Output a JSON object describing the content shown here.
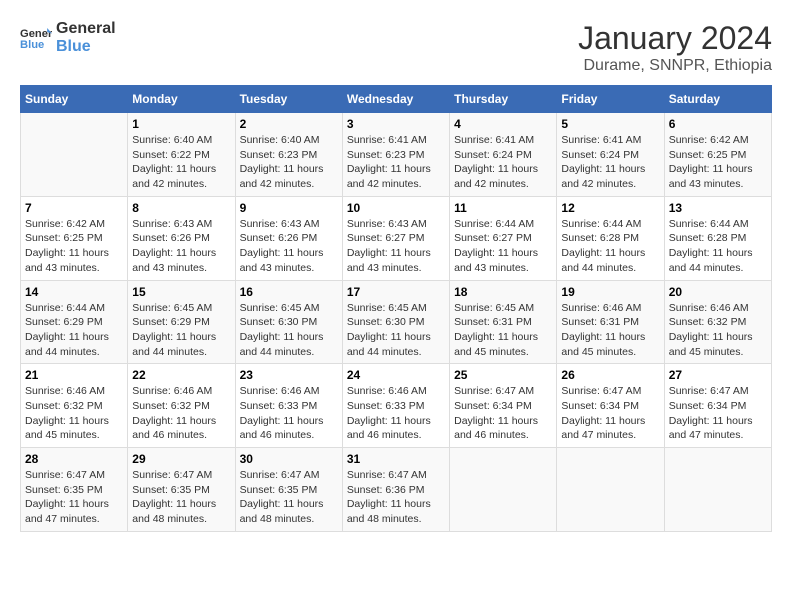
{
  "logo": {
    "line1": "General",
    "line2": "Blue"
  },
  "title": "January 2024",
  "subtitle": "Durame, SNNPR, Ethiopia",
  "days_header": [
    "Sunday",
    "Monday",
    "Tuesday",
    "Wednesday",
    "Thursday",
    "Friday",
    "Saturday"
  ],
  "weeks": [
    [
      {
        "day": "",
        "info": ""
      },
      {
        "day": "1",
        "info": "Sunrise: 6:40 AM\nSunset: 6:22 PM\nDaylight: 11 hours\nand 42 minutes."
      },
      {
        "day": "2",
        "info": "Sunrise: 6:40 AM\nSunset: 6:23 PM\nDaylight: 11 hours\nand 42 minutes."
      },
      {
        "day": "3",
        "info": "Sunrise: 6:41 AM\nSunset: 6:23 PM\nDaylight: 11 hours\nand 42 minutes."
      },
      {
        "day": "4",
        "info": "Sunrise: 6:41 AM\nSunset: 6:24 PM\nDaylight: 11 hours\nand 42 minutes."
      },
      {
        "day": "5",
        "info": "Sunrise: 6:41 AM\nSunset: 6:24 PM\nDaylight: 11 hours\nand 42 minutes."
      },
      {
        "day": "6",
        "info": "Sunrise: 6:42 AM\nSunset: 6:25 PM\nDaylight: 11 hours\nand 43 minutes."
      }
    ],
    [
      {
        "day": "7",
        "info": "Sunrise: 6:42 AM\nSunset: 6:25 PM\nDaylight: 11 hours\nand 43 minutes."
      },
      {
        "day": "8",
        "info": "Sunrise: 6:43 AM\nSunset: 6:26 PM\nDaylight: 11 hours\nand 43 minutes."
      },
      {
        "day": "9",
        "info": "Sunrise: 6:43 AM\nSunset: 6:26 PM\nDaylight: 11 hours\nand 43 minutes."
      },
      {
        "day": "10",
        "info": "Sunrise: 6:43 AM\nSunset: 6:27 PM\nDaylight: 11 hours\nand 43 minutes."
      },
      {
        "day": "11",
        "info": "Sunrise: 6:44 AM\nSunset: 6:27 PM\nDaylight: 11 hours\nand 43 minutes."
      },
      {
        "day": "12",
        "info": "Sunrise: 6:44 AM\nSunset: 6:28 PM\nDaylight: 11 hours\nand 44 minutes."
      },
      {
        "day": "13",
        "info": "Sunrise: 6:44 AM\nSunset: 6:28 PM\nDaylight: 11 hours\nand 44 minutes."
      }
    ],
    [
      {
        "day": "14",
        "info": "Sunrise: 6:44 AM\nSunset: 6:29 PM\nDaylight: 11 hours\nand 44 minutes."
      },
      {
        "day": "15",
        "info": "Sunrise: 6:45 AM\nSunset: 6:29 PM\nDaylight: 11 hours\nand 44 minutes."
      },
      {
        "day": "16",
        "info": "Sunrise: 6:45 AM\nSunset: 6:30 PM\nDaylight: 11 hours\nand 44 minutes."
      },
      {
        "day": "17",
        "info": "Sunrise: 6:45 AM\nSunset: 6:30 PM\nDaylight: 11 hours\nand 44 minutes."
      },
      {
        "day": "18",
        "info": "Sunrise: 6:45 AM\nSunset: 6:31 PM\nDaylight: 11 hours\nand 45 minutes."
      },
      {
        "day": "19",
        "info": "Sunrise: 6:46 AM\nSunset: 6:31 PM\nDaylight: 11 hours\nand 45 minutes."
      },
      {
        "day": "20",
        "info": "Sunrise: 6:46 AM\nSunset: 6:32 PM\nDaylight: 11 hours\nand 45 minutes."
      }
    ],
    [
      {
        "day": "21",
        "info": "Sunrise: 6:46 AM\nSunset: 6:32 PM\nDaylight: 11 hours\nand 45 minutes."
      },
      {
        "day": "22",
        "info": "Sunrise: 6:46 AM\nSunset: 6:32 PM\nDaylight: 11 hours\nand 46 minutes."
      },
      {
        "day": "23",
        "info": "Sunrise: 6:46 AM\nSunset: 6:33 PM\nDaylight: 11 hours\nand 46 minutes."
      },
      {
        "day": "24",
        "info": "Sunrise: 6:46 AM\nSunset: 6:33 PM\nDaylight: 11 hours\nand 46 minutes."
      },
      {
        "day": "25",
        "info": "Sunrise: 6:47 AM\nSunset: 6:34 PM\nDaylight: 11 hours\nand 46 minutes."
      },
      {
        "day": "26",
        "info": "Sunrise: 6:47 AM\nSunset: 6:34 PM\nDaylight: 11 hours\nand 47 minutes."
      },
      {
        "day": "27",
        "info": "Sunrise: 6:47 AM\nSunset: 6:34 PM\nDaylight: 11 hours\nand 47 minutes."
      }
    ],
    [
      {
        "day": "28",
        "info": "Sunrise: 6:47 AM\nSunset: 6:35 PM\nDaylight: 11 hours\nand 47 minutes."
      },
      {
        "day": "29",
        "info": "Sunrise: 6:47 AM\nSunset: 6:35 PM\nDaylight: 11 hours\nand 48 minutes."
      },
      {
        "day": "30",
        "info": "Sunrise: 6:47 AM\nSunset: 6:35 PM\nDaylight: 11 hours\nand 48 minutes."
      },
      {
        "day": "31",
        "info": "Sunrise: 6:47 AM\nSunset: 6:36 PM\nDaylight: 11 hours\nand 48 minutes."
      },
      {
        "day": "",
        "info": ""
      },
      {
        "day": "",
        "info": ""
      },
      {
        "day": "",
        "info": ""
      }
    ]
  ]
}
